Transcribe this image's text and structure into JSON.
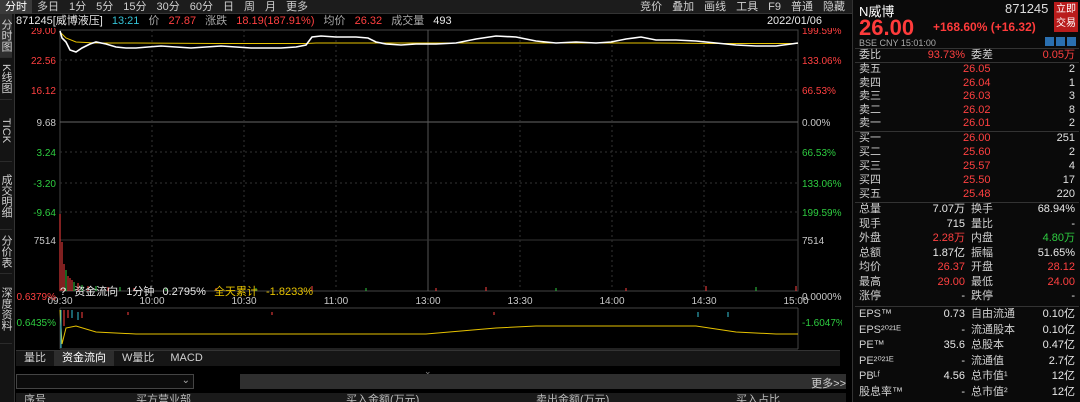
{
  "topbar": {
    "left": [
      "分时",
      "多日",
      "1分",
      "5分",
      "15分",
      "30分",
      "60分",
      "日",
      "周",
      "月",
      "更多"
    ],
    "right": [
      "竞价",
      "叠加",
      "画线",
      "工具",
      "F9",
      "普通",
      "隐藏"
    ]
  },
  "rail": [
    "分时图",
    "K线图",
    "TICK",
    "成交明细",
    "分价表",
    "深度资料"
  ],
  "header": {
    "code_name": "871245[威博液压]",
    "time": "13:21",
    "price_label": "价",
    "price": "27.87",
    "change_label": "涨跌",
    "change": "18.19(187.91%)",
    "avg_label": "均价",
    "avg": "26.32",
    "vol_label": "成交量",
    "vol": "493",
    "date": "2022/01/06"
  },
  "left_axis": [
    "29.00",
    "22.56",
    "16.12",
    "9.68",
    "3.24",
    "-3.20",
    "-9.64",
    "7514"
  ],
  "right_axis": [
    "199.59%",
    "133.06%",
    "66.53%",
    "0.00%",
    "66.53%",
    "133.06%",
    "199.59%",
    "7514"
  ],
  "time_axis": [
    "09:30",
    "10:00",
    "10:30",
    "11:00",
    "13:00",
    "13:30",
    "14:00",
    "14:30",
    "15:00"
  ],
  "flow": {
    "label": "资金流向",
    "minute_label": "1分钟",
    "minute_value": "0.2795%",
    "day_label": "全天累计",
    "day_value": "-1.8233%",
    "left_axis": [
      "0.6379%",
      "-0.6435%"
    ],
    "right_axis": [
      "0.0000%",
      "-1.6047%"
    ]
  },
  "tabs": [
    "量比",
    "资金流向",
    "W量比",
    "MACD"
  ],
  "more": "更多>>",
  "table_headers": [
    "序号",
    "买方营业部",
    "买入金额(万元)",
    "卖出金额(万元)",
    "买入占比"
  ],
  "panel": {
    "name": "N威博",
    "code": "871245",
    "trade_button": "立即交易",
    "price": "26.00",
    "change": "+168.60% (+16.32)",
    "exchange": "BSE CNY 15:01:00",
    "weibi": {
      "label": "委比",
      "value": "93.73%",
      "label2": "委差",
      "value2": "0.05万"
    },
    "asks": [
      {
        "label": "卖五",
        "price": "26.05",
        "vol": "2"
      },
      {
        "label": "卖四",
        "price": "26.04",
        "vol": "1"
      },
      {
        "label": "卖三",
        "price": "26.03",
        "vol": "3"
      },
      {
        "label": "卖二",
        "price": "26.02",
        "vol": "8"
      },
      {
        "label": "卖一",
        "price": "26.01",
        "vol": "2"
      }
    ],
    "bids": [
      {
        "label": "买一",
        "price": "26.00",
        "vol": "251"
      },
      {
        "label": "买二",
        "price": "25.60",
        "vol": "2"
      },
      {
        "label": "买三",
        "price": "25.57",
        "vol": "4"
      },
      {
        "label": "买四",
        "price": "25.50",
        "vol": "17"
      },
      {
        "label": "买五",
        "price": "25.48",
        "vol": "220"
      }
    ],
    "stats": [
      {
        "l1": "总量",
        "v1": "7.07万",
        "l2": "换手",
        "v2": "68.94%",
        "c1": "white",
        "c2": "white"
      },
      {
        "l1": "现手",
        "v1": "715",
        "l2": "量比",
        "v2": "-",
        "c1": "white",
        "c2": "white"
      },
      {
        "l1": "外盘",
        "v1": "2.28万",
        "l2": "内盘",
        "v2": "4.80万",
        "c1": "red",
        "c2": "green"
      },
      {
        "l1": "总额",
        "v1": "1.87亿",
        "l2": "振幅",
        "v2": "51.65%",
        "c1": "white",
        "c2": "white"
      },
      {
        "l1": "均价",
        "v1": "26.37",
        "l2": "开盘",
        "v2": "28.12",
        "c1": "red",
        "c2": "red"
      },
      {
        "l1": "最高",
        "v1": "29.00",
        "l2": "最低",
        "v2": "24.00",
        "c1": "red",
        "c2": "red"
      },
      {
        "l1": "涨停",
        "v1": "-",
        "l2": "跌停",
        "v2": "-",
        "c1": "white",
        "c2": "white"
      }
    ],
    "fundamentals": [
      {
        "l1": "EPS™",
        "v1": "0.73",
        "l2": "自由流通",
        "v2": "0.10亿"
      },
      {
        "l1": "EPS²⁰²¹ᴱ",
        "v1": "-",
        "l2": "流通股本",
        "v2": "0.10亿"
      },
      {
        "l1": "PE™",
        "v1": "35.6",
        "l2": "总股本",
        "v2": "0.47亿"
      },
      {
        "l1": "PE²⁰²¹ᴱ",
        "v1": "-",
        "l2": "流通值",
        "v2": "2.7亿"
      },
      {
        "l1": "PBᴸᶠ",
        "v1": "4.56",
        "l2": "总市值¹",
        "v2": "12亿"
      },
      {
        "l1": "股息率™",
        "v1": "-",
        "l2": "总市值²",
        "v2": "12亿"
      }
    ]
  },
  "colors": {
    "price_line": "#ffffff",
    "avg_line": "#e6c200",
    "up": "#ff4040",
    "down": "#2ecc40",
    "accent": "#34c3d6"
  }
}
